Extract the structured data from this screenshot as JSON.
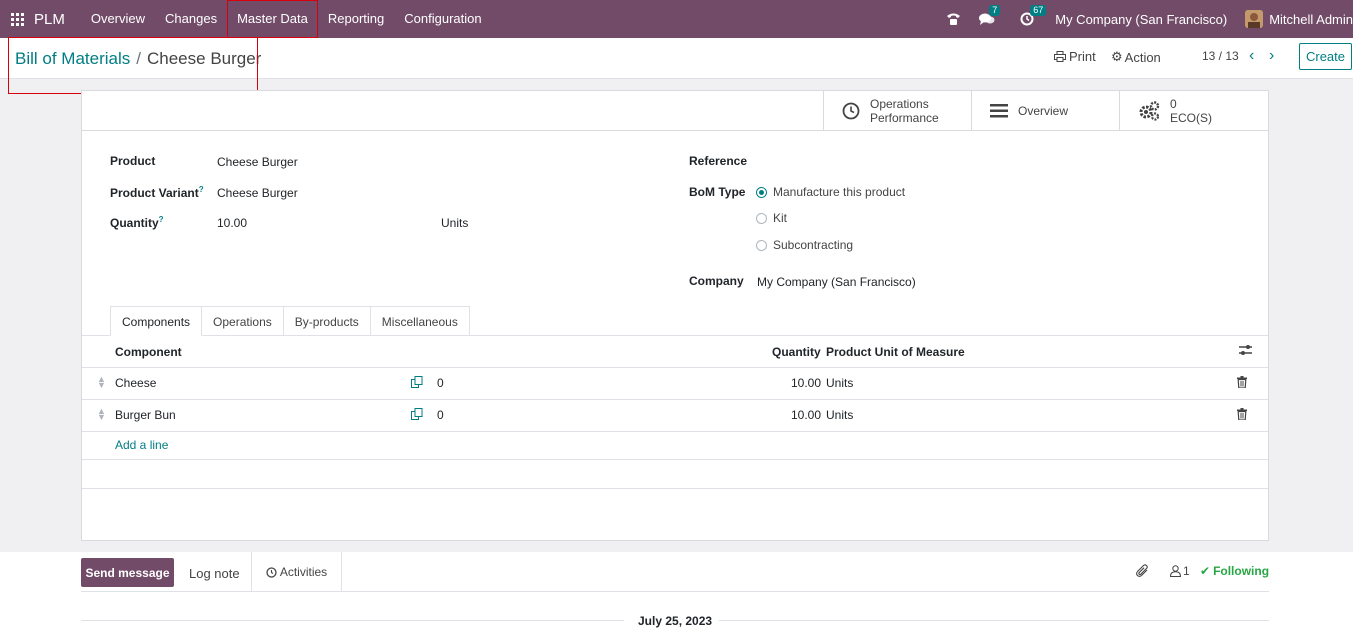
{
  "navbar": {
    "app_name": "PLM",
    "menu": [
      "Overview",
      "Changes",
      "Master Data",
      "Reporting",
      "Configuration"
    ],
    "messages_count": "7",
    "activities_count": "67",
    "company": "My Company (San Francisco)",
    "user": "Mitchell Admin"
  },
  "breadcrumb": {
    "parent": "Bill of Materials",
    "separator": "/",
    "current": "Cheese Burger"
  },
  "control_panel": {
    "print_label": "Print",
    "action_label": "Action",
    "pager": "13 / 13",
    "create_label": "Create"
  },
  "stat_buttons": {
    "operations": [
      "Operations",
      "Performance"
    ],
    "overview": "Overview",
    "eco_count": "0",
    "eco_label": "ECO(S)"
  },
  "form": {
    "product_label": "Product",
    "product_value": "Cheese Burger",
    "variant_label": "Product Variant",
    "variant_value": "Cheese Burger",
    "quantity_label": "Quantity",
    "quantity_value": "10.00",
    "quantity_uom": "Units",
    "help_marker": "?",
    "reference_label": "Reference",
    "bom_type_label": "BoM Type",
    "bom_type_options": [
      "Manufacture this product",
      "Kit",
      "Subcontracting"
    ],
    "bom_type_selected": 0,
    "company_label": "Company",
    "company_value": "My Company (San Francisco)"
  },
  "tabs": [
    "Components",
    "Operations",
    "By-products",
    "Miscellaneous"
  ],
  "components_table": {
    "headers": {
      "component": "Component",
      "quantity": "Quantity",
      "uom": "Product Unit of Measure"
    },
    "rows": [
      {
        "component": "Cheese",
        "variants": "0",
        "quantity": "10.00",
        "uom": "Units"
      },
      {
        "component": "Burger Bun",
        "variants": "0",
        "quantity": "10.00",
        "uom": "Units"
      }
    ],
    "add_line": "Add a line"
  },
  "chatter": {
    "send_message": "Send message",
    "log_note": "Log note",
    "activities": "Activities",
    "followers_count": "1",
    "following": "Following",
    "date": "July 25, 2023"
  },
  "colors": {
    "brand": "#714b67",
    "accent": "#017e84",
    "highlight_box": "#d9000d",
    "following": "#28a745"
  }
}
